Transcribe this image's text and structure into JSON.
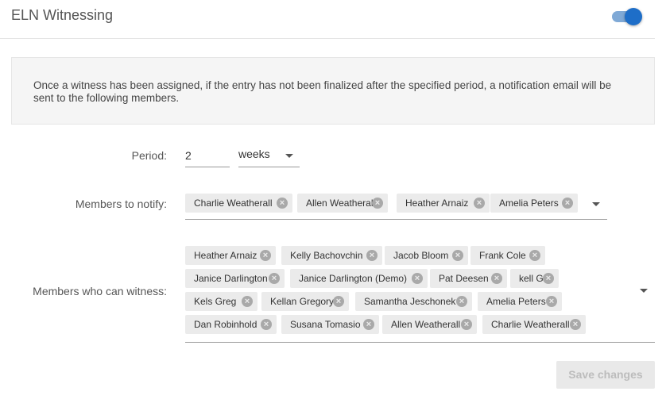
{
  "header": {
    "title": "ELN Witnessing",
    "toggle_on": true,
    "accent_color": "#1e6ec8"
  },
  "info": {
    "text": "Once a witness has been assigned, if the entry has not been finalized after the specified period, a notification email will be sent to the following members."
  },
  "period": {
    "label": "Period:",
    "value": "2",
    "unit": "weeks"
  },
  "notify": {
    "label": "Members to notify:",
    "members": [
      "Charlie Weatherall",
      "Allen Weatherall",
      "Heather Arnaiz",
      "Amelia Peters"
    ]
  },
  "witness": {
    "label": "Members who can witness:",
    "members": [
      "Heather Arnaiz",
      "Kelly Bachovchin",
      "Jacob Bloom",
      "Frank Cole",
      "Janice Darlington",
      "Janice Darlington (Demo)",
      "Pat Deesen",
      "kell G",
      "Kels Greg",
      "Kellan Gregory",
      "Samantha Jeschonek",
      "Amelia Peters",
      "Dan Robinhold",
      "Susana Tomasio",
      "Allen Weatherall",
      "Charlie Weatherall"
    ]
  },
  "actions": {
    "save_label": "Save changes"
  },
  "icons": {
    "remove": "close-circle-icon",
    "dropdown": "caret-down-icon"
  }
}
